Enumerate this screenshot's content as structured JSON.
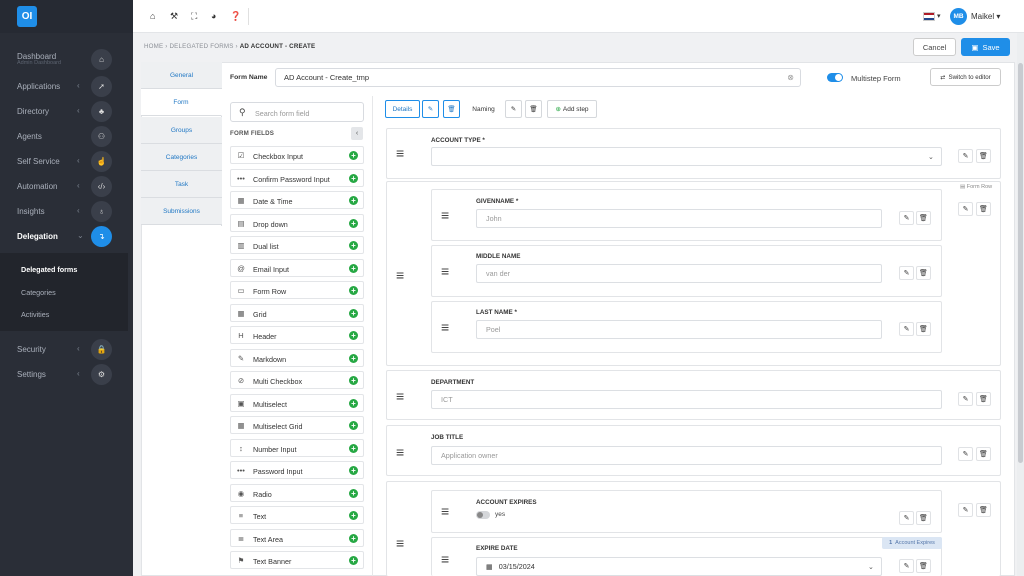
{
  "app": {
    "logo": "OI"
  },
  "sidebar": {
    "items": [
      {
        "label": "Dashboard",
        "sub": "Admin Dashboard",
        "icon": "home-icon",
        "glyph": "⌂",
        "chev": ""
      },
      {
        "label": "Applications",
        "sub": "",
        "icon": "rocket-icon",
        "glyph": "➚",
        "chev": "‹"
      },
      {
        "label": "Directory",
        "sub": "",
        "icon": "sitemap-icon",
        "glyph": "♣",
        "chev": "‹"
      },
      {
        "label": "Agents",
        "sub": "",
        "icon": "users-icon",
        "glyph": "⚇",
        "chev": ""
      },
      {
        "label": "Self Service",
        "sub": "",
        "icon": "hand-icon",
        "glyph": "☝",
        "chev": "‹"
      },
      {
        "label": "Automation",
        "sub": "",
        "icon": "code-icon",
        "glyph": "‹/›",
        "chev": "‹"
      },
      {
        "label": "Insights",
        "sub": "",
        "icon": "lightbulb-icon",
        "glyph": "♁",
        "chev": "‹"
      },
      {
        "label": "Delegation",
        "sub": "",
        "icon": "delegation-icon",
        "glyph": "↴",
        "chev": "⌄"
      },
      {
        "label": "Security",
        "sub": "",
        "icon": "lock-icon",
        "glyph": "🔒",
        "chev": "‹"
      },
      {
        "label": "Settings",
        "sub": "",
        "icon": "gear-icon",
        "glyph": "⚙",
        "chev": "‹"
      }
    ],
    "subitems": [
      "Delegated forms",
      "Categories",
      "Activities"
    ]
  },
  "topbar": {
    "user_initials": "MB",
    "user_name": "Maikel ▾",
    "flag_caret": "▾"
  },
  "breadcrumb": {
    "home": "HOME",
    "sep": "›",
    "section": "DELEGATED FORMS",
    "current": "AD ACCOUNT - CREATE"
  },
  "actions": {
    "cancel": "Cancel",
    "save": "Save"
  },
  "tabs": [
    "General",
    "Form",
    "Groups",
    "Categories",
    "Task",
    "Submissions"
  ],
  "form": {
    "name_label": "Form Name",
    "name_value": "AD Account - Create_tmp",
    "multistep_label": "Multistep Form",
    "multistep_on": true,
    "switch_label": "Switch to editor"
  },
  "palette": {
    "search_placeholder": "Search form field",
    "header": "FORM FIELDS",
    "items": [
      {
        "label": "Checkbox Input",
        "glyph": "☑"
      },
      {
        "label": "Confirm Password Input",
        "glyph": "•••"
      },
      {
        "label": "Date & Time",
        "glyph": "▦"
      },
      {
        "label": "Drop down",
        "glyph": "▤"
      },
      {
        "label": "Dual list",
        "glyph": "▥"
      },
      {
        "label": "Email Input",
        "glyph": "@"
      },
      {
        "label": "Form Row",
        "glyph": "▭"
      },
      {
        "label": "Grid",
        "glyph": "▦"
      },
      {
        "label": "Header",
        "glyph": "H"
      },
      {
        "label": "Markdown",
        "glyph": "✎"
      },
      {
        "label": "Multi Checkbox",
        "glyph": "⊘"
      },
      {
        "label": "Multiselect",
        "glyph": "▣"
      },
      {
        "label": "Multiselect Grid",
        "glyph": "▦"
      },
      {
        "label": "Number Input",
        "glyph": "↕"
      },
      {
        "label": "Password Input",
        "glyph": "•••"
      },
      {
        "label": "Radio",
        "glyph": "◉"
      },
      {
        "label": "Text",
        "glyph": "≡"
      },
      {
        "label": "Text Area",
        "glyph": "≣"
      },
      {
        "label": "Text Banner",
        "glyph": "⚑"
      }
    ]
  },
  "steps": {
    "details": "Details",
    "naming": "Naming",
    "add_step": "Add step"
  },
  "canvas": {
    "account_type": {
      "label": "ACCOUNT TYPE *"
    },
    "form_row_tag": "Form Row",
    "givenname": {
      "label": "GIVENNAME *",
      "placeholder": "John"
    },
    "middlename": {
      "label": "MIDDLE NAME",
      "placeholder": "van der"
    },
    "lastname": {
      "label": "LAST NAME *",
      "placeholder": "Poel"
    },
    "department": {
      "label": "DEPARTMENT",
      "placeholder": "ICT"
    },
    "jobtitle": {
      "label": "JOB TITLE",
      "placeholder": "Application owner"
    },
    "account_expires": {
      "label": "ACCOUNT EXPIRES",
      "toggle_label": "yes"
    },
    "expire_date": {
      "label": "EXPIRE DATE",
      "value": "03/15/2024",
      "condition": "Account Expires",
      "condition_count": "1"
    }
  },
  "colors": {
    "accent": "#1f8ee8",
    "sidebar": "#2a2e37",
    "add": "#27a844"
  }
}
